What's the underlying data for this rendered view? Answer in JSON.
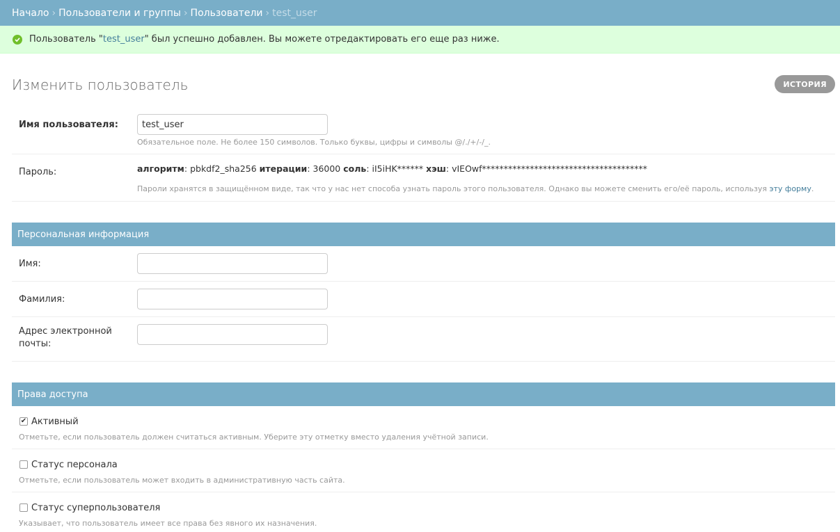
{
  "breadcrumbs": {
    "items": [
      "Начало",
      "Пользователи и группы",
      "Пользователи"
    ],
    "current": "test_user",
    "sep": "›"
  },
  "message": {
    "prefix": "Пользователь \"",
    "link": "test_user",
    "suffix": "\" был успешно добавлен. Вы можете отредактировать его еще раз ниже."
  },
  "page": {
    "title": "Изменить пользователь",
    "history_label": "ИСТОРИЯ"
  },
  "username": {
    "label": "Имя пользователя:",
    "value": "test_user",
    "help": "Обязательное поле. Не более 150 символов. Только буквы, цифры и символы @/./+/-/_."
  },
  "password": {
    "label": "Пароль:",
    "algorithm_label": "алгоритм",
    "algorithm_value": ": pbkdf2_sha256 ",
    "iterations_label": "итерации",
    "iterations_value": ": 36000 ",
    "salt_label": "соль",
    "salt_value": ": iI5iHK****** ",
    "hash_label": "хэш",
    "hash_value": ": vIEOwf**************************************",
    "help_text": "Пароли хранятся в защищённом виде, так что у нас нет способа узнать пароль этого пользователя. Однако вы можете сменить его/её пароль, используя ",
    "help_link": "эту форму",
    "help_end": "."
  },
  "personal": {
    "header": "Персональная информация",
    "first_name_label": "Имя:",
    "last_name_label": "Фамилия:",
    "email_label_1": "Адрес электронной",
    "email_label_2": "почты:"
  },
  "permissions": {
    "header": "Права доступа",
    "active_label": "Активный",
    "active_help": "Отметьте, если пользователь должен считаться активным. Уберите эту отметку вместо удаления учётной записи.",
    "staff_label": "Статус персонала",
    "staff_help": "Отметьте, если пользователь может входить в административную часть сайта.",
    "superuser_label": "Статус суперпользователя",
    "superuser_help": "Указывает, что пользователь имеет все права без явного их назначения."
  },
  "icons": {
    "success": "success-check-icon",
    "checkmark": "✔"
  }
}
